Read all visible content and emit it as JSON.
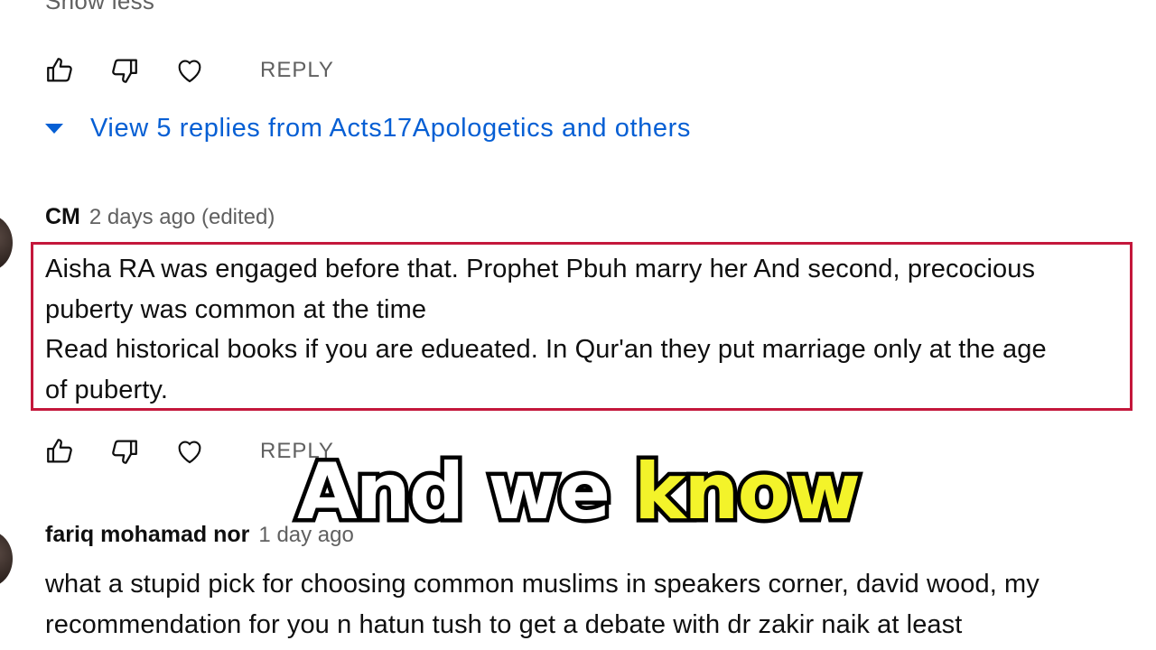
{
  "show_less": "Show less",
  "comment1": {
    "actions": {
      "reply_label": "REPLY"
    }
  },
  "view_replies": "View 5 replies from Acts17Apologetics and others",
  "comment2": {
    "author": "CM",
    "time": "2 days ago (edited)",
    "lines": [
      "Aisha RA was engaged before that. Prophet Pbuh marry her  And second, precocious",
      "puberty was common at the time",
      "Read historical books if you are edueated. In Qur'an they put marriage only at the age",
      "of puberty."
    ],
    "actions": {
      "reply_label": "REPLY"
    }
  },
  "comment3": {
    "author": "fariq mohamad nor",
    "time": "1 day ago",
    "lines": [
      "what a stupid pick for choosing common muslims in speakers corner, david wood, my",
      "recommendation for  you n hatun tush to get a debate with dr zakir naik at least"
    ]
  },
  "caption": {
    "word1": "And we",
    "word2": "know"
  },
  "colors": {
    "link": "#065fd4",
    "highlight_border": "#c4173b",
    "caption_accent": "#f3f32a"
  }
}
